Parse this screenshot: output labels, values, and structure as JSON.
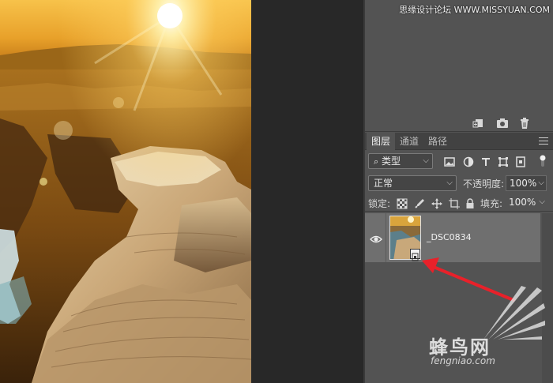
{
  "watermark_top": "思缘设计论坛 WWW.MISSYUAN.COM",
  "layers_panel": {
    "tabs": [
      {
        "label": "图层",
        "active": true
      },
      {
        "label": "通道",
        "active": false
      },
      {
        "label": "路径",
        "active": false
      }
    ],
    "filter": {
      "label": "类型"
    },
    "blend_mode": "正常",
    "opacity_label": "不透明度:",
    "opacity_value": "100%",
    "lock_label": "锁定:",
    "fill_label": "填充:",
    "fill_value": "100%",
    "layers": [
      {
        "name": "_DSC0834",
        "visible": true,
        "smart_object": true
      }
    ]
  },
  "footer_icons": [
    "new-snapshot-icon",
    "camera-icon",
    "trash-icon"
  ],
  "filter_icons": [
    "image-filter-icon",
    "adjustment-filter-icon",
    "type-filter-icon",
    "shape-filter-icon",
    "smart-object-filter-icon",
    "filter-toggle-icon"
  ],
  "lock_icons": [
    "lock-transparent-icon",
    "lock-image-icon",
    "lock-position-icon",
    "lock-artboard-icon",
    "lock-all-icon"
  ],
  "watermark": {
    "name": "蜂鸟网",
    "domain": "fengniao.com"
  },
  "colors": {
    "panel_bg": "#535353",
    "canvas_bg": "#282828",
    "selected_layer": "#6f6f6f",
    "arrow": "#e8212a"
  }
}
